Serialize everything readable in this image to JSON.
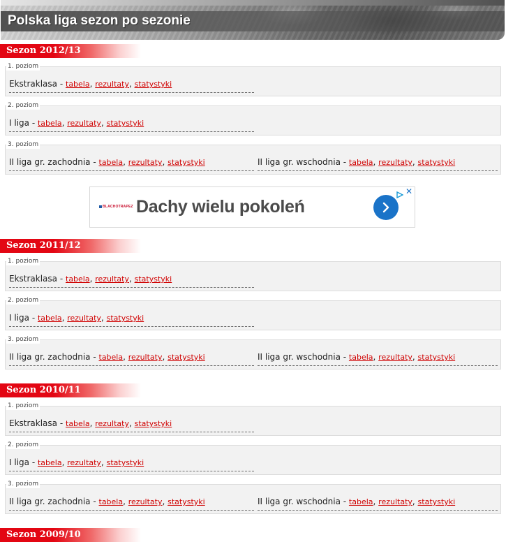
{
  "page": {
    "title": "Polska liga sezon po sezonie"
  },
  "link_labels": {
    "table": "tabela",
    "results": "rezultaty",
    "stats": "statystyki"
  },
  "colors": {
    "accent": "#e30613",
    "link": "#d00000",
    "box_bg": "#f2f2f2",
    "ad_button": "#1a73c8"
  },
  "ad": {
    "brand": "BLACHOTRAPEZ",
    "headline": "Dachy wielu pokoleń",
    "cta_icon": "chevron-right-icon",
    "info_icon": "adchoices-icon",
    "close_icon": "close-icon"
  },
  "seasons": [
    {
      "name": "Sezon 2012/13",
      "levels": [
        {
          "label": "1. poziom",
          "leagues": [
            {
              "name": "Ekstraklasa"
            }
          ]
        },
        {
          "label": "2. poziom",
          "leagues": [
            {
              "name": "I liga"
            }
          ]
        },
        {
          "label": "3. poziom",
          "leagues": [
            {
              "name": "II liga gr. zachodnia"
            },
            {
              "name": "II liga gr. wschodnia"
            }
          ]
        }
      ]
    },
    {
      "name": "Sezon 2011/12",
      "levels": [
        {
          "label": "1. poziom",
          "leagues": [
            {
              "name": "Ekstraklasa"
            }
          ]
        },
        {
          "label": "2. poziom",
          "leagues": [
            {
              "name": "I liga"
            }
          ]
        },
        {
          "label": "3. poziom",
          "leagues": [
            {
              "name": "II liga gr. zachodnia"
            },
            {
              "name": "II liga gr. wschodnia"
            }
          ]
        }
      ]
    },
    {
      "name": "Sezon 2010/11",
      "levels": [
        {
          "label": "1. poziom",
          "leagues": [
            {
              "name": "Ekstraklasa"
            }
          ]
        },
        {
          "label": "2. poziom",
          "leagues": [
            {
              "name": "I liga"
            }
          ]
        },
        {
          "label": "3. poziom",
          "leagues": [
            {
              "name": "II liga gr. zachodnia"
            },
            {
              "name": "II liga gr. wschodnia"
            }
          ]
        }
      ]
    },
    {
      "name": "Sezon 2009/10",
      "levels": []
    }
  ]
}
